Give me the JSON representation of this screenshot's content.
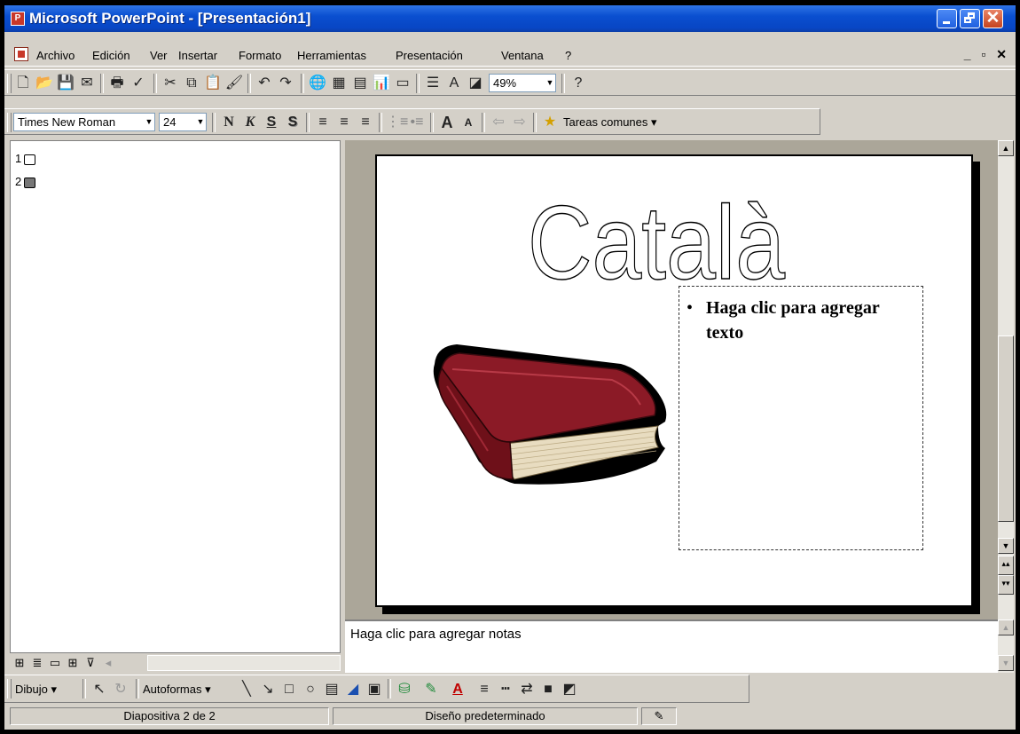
{
  "window": {
    "title": "Microsoft PowerPoint - [Presentación1]"
  },
  "menu": [
    "Archivo",
    "Edición",
    "Ver",
    "Insertar",
    "Formato",
    "Herramientas",
    "Presentación",
    "Ventana",
    "?"
  ],
  "standard_toolbar": {
    "zoom": "49%"
  },
  "formatting_toolbar": {
    "font": "Times New Roman",
    "size": "24",
    "bold": "N",
    "italic": "K",
    "underline": "S",
    "shadow": "S",
    "tasks_label": "Tareas comunes"
  },
  "outline": {
    "slides": [
      "1",
      "2"
    ]
  },
  "slide": {
    "title_wordart": "Català",
    "bullet": "•",
    "placeholder_text": "Haga clic para agregar texto",
    "book_colors": {
      "cover": "#8b1a26",
      "pages": "#e8dcc0"
    }
  },
  "notes": {
    "placeholder": "Haga clic para agregar notas"
  },
  "drawing_toolbar": {
    "draw_label": "Dibujo",
    "autoshapes_label": "Autoformas"
  },
  "status": {
    "slide_info": "Diapositiva 2 de 2",
    "design": "Diseño predeterminado"
  }
}
